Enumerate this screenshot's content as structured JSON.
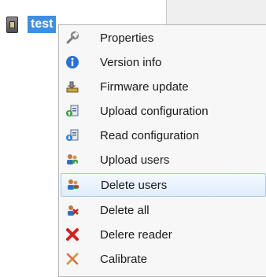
{
  "tree": {
    "node_label": "test"
  },
  "context_menu": {
    "items": [
      {
        "label": "Properties",
        "icon": "wrench-icon"
      },
      {
        "label": "Version info",
        "icon": "info-icon"
      },
      {
        "label": "Firmware update",
        "icon": "firmware-icon"
      },
      {
        "label": "Upload configuration",
        "icon": "upload-config-icon"
      },
      {
        "label": "Read configuration",
        "icon": "read-config-icon"
      },
      {
        "label": "Upload users",
        "icon": "upload-users-icon"
      },
      {
        "label": "Delete users",
        "icon": "delete-users-icon"
      },
      {
        "label": "Delete all",
        "icon": "delete-all-icon"
      },
      {
        "label": "Delere reader",
        "icon": "delete-reader-icon"
      },
      {
        "label": "Calibrate",
        "icon": "calibrate-icon"
      }
    ],
    "highlighted_item": "Delete users"
  },
  "colors": {
    "selection": "#3f8fe0",
    "menu_background": "#f7f7f7",
    "hover_border": "#a9c7ec"
  }
}
